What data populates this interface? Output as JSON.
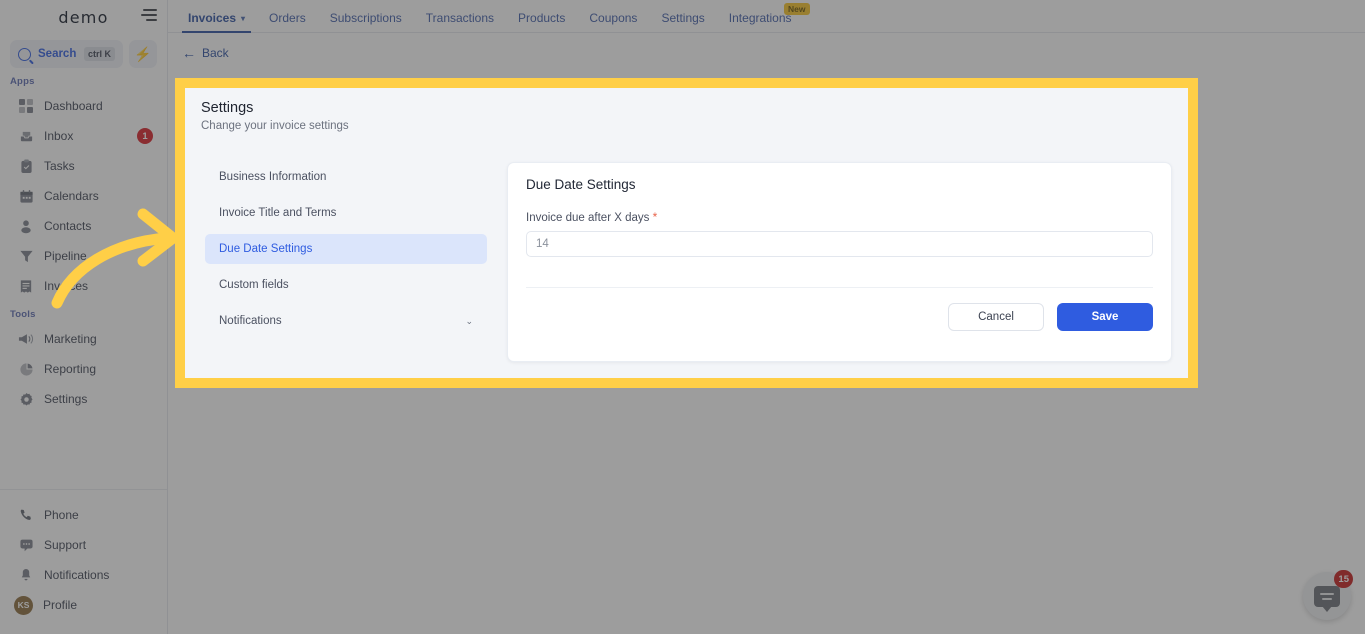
{
  "sidebar": {
    "brand": "demo",
    "search": {
      "label": "Search",
      "shortcut": "ctrl K",
      "bolt_icon": "lightning-bolt-icon"
    },
    "sections": [
      {
        "label": "Apps",
        "items": [
          {
            "label": "Dashboard",
            "icon": "dashboard-icon",
            "badge": ""
          },
          {
            "label": "Inbox",
            "icon": "inbox-icon",
            "badge": "1"
          },
          {
            "label": "Tasks",
            "icon": "tasks-icon",
            "badge": ""
          },
          {
            "label": "Calendars",
            "icon": "calendar-icon",
            "badge": ""
          },
          {
            "label": "Contacts",
            "icon": "contacts-icon",
            "badge": ""
          },
          {
            "label": "Pipeline",
            "icon": "pipeline-icon",
            "badge": ""
          },
          {
            "label": "Invoices",
            "icon": "invoices-icon",
            "badge": ""
          }
        ]
      },
      {
        "label": "Tools",
        "items": [
          {
            "label": "Marketing",
            "icon": "megaphone-icon",
            "badge": ""
          },
          {
            "label": "Reporting",
            "icon": "pie-chart-icon",
            "badge": ""
          },
          {
            "label": "Settings",
            "icon": "gear-icon",
            "badge": ""
          }
        ]
      }
    ],
    "bottom_items": [
      {
        "label": "Phone",
        "icon": "phone-icon"
      },
      {
        "label": "Support",
        "icon": "support-chat-icon"
      },
      {
        "label": "Notifications",
        "icon": "bell-icon"
      },
      {
        "label": "Profile",
        "icon": "avatar-icon",
        "initials": "KS"
      }
    ]
  },
  "topnav": {
    "collapse_icon": "collapse-menu-icon",
    "tabs": [
      {
        "label": "Invoices",
        "active": true,
        "chevron": true,
        "badge": ""
      },
      {
        "label": "Orders",
        "active": false,
        "chevron": false,
        "badge": ""
      },
      {
        "label": "Subscriptions",
        "active": false,
        "chevron": false,
        "badge": ""
      },
      {
        "label": "Transactions",
        "active": false,
        "chevron": false,
        "badge": ""
      },
      {
        "label": "Products",
        "active": false,
        "chevron": false,
        "badge": ""
      },
      {
        "label": "Coupons",
        "active": false,
        "chevron": false,
        "badge": ""
      },
      {
        "label": "Settings",
        "active": false,
        "chevron": false,
        "badge": ""
      },
      {
        "label": "Integrations",
        "active": false,
        "chevron": false,
        "badge": "New"
      }
    ]
  },
  "back": {
    "label": "Back",
    "icon": "arrow-left-icon"
  },
  "panel": {
    "title": "Settings",
    "subtitle": "Change your invoice settings",
    "menu": [
      {
        "label": "Business Information",
        "active": false,
        "chevron": false
      },
      {
        "label": "Invoice Title and Terms",
        "active": false,
        "chevron": false
      },
      {
        "label": "Due Date Settings",
        "active": true,
        "chevron": false
      },
      {
        "label": "Custom fields",
        "active": false,
        "chevron": false
      },
      {
        "label": "Notifications",
        "active": false,
        "chevron": true
      }
    ]
  },
  "card": {
    "title": "Due Date Settings",
    "field_label": "Invoice due after X days",
    "required_mark": "*",
    "input_value": "14",
    "input_placeholder": "14",
    "cancel_label": "Cancel",
    "save_label": "Save"
  },
  "chat": {
    "badge": "15",
    "icon": "chat-bubble-icon"
  },
  "colors": {
    "highlight_yellow": "#ffcf47",
    "primary_blue": "#2f5ce0",
    "nav_blue": "#2b4fa0",
    "panel_bg": "#f3f5f8",
    "active_menu_bg": "#dbe5fb",
    "badge_red": "#d81f26",
    "new_badge": "#f6c324",
    "dim_overlay": "#7c7c7c"
  }
}
